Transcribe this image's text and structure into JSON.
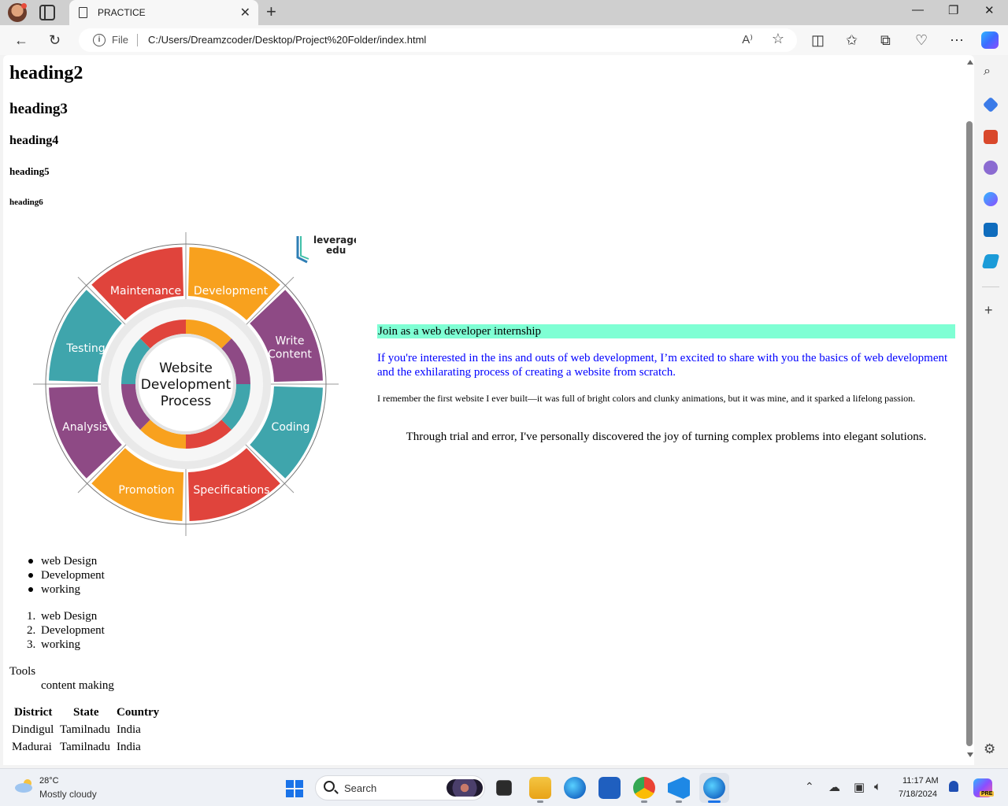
{
  "browser": {
    "tab_title": "PRACTICE",
    "file_label": "File",
    "url": "C:/Users/Dreamzcoder/Desktop/Project%20Folder/index.html"
  },
  "page": {
    "headings": {
      "h2": "heading2",
      "h3": "heading3",
      "h4": "heading4",
      "h5": "heading5",
      "h6": "heading6"
    },
    "diagram": {
      "brand_top": "leverage",
      "brand_bottom": "edu",
      "center_lines": [
        "Website",
        "Development",
        "Process"
      ],
      "segments": [
        "Development",
        "Write Content",
        "Coding",
        "Specifications",
        "Promotion",
        "Analysis",
        "Testing",
        "Maintenance"
      ]
    },
    "banner": "Join as a web developer internship",
    "intro": "If you're interested in the ins and outs of web development, I’m excited to share with you the basics of web development and the exhilarating process of creating a website from scratch.",
    "memory": "I remember the first website I ever built—it was full of bright colors and clunky animations, but it was mine, and it sparked a lifelong passion.",
    "trial": "Through trial and error, I've personally discovered the joy of turning complex problems into elegant solutions.",
    "unordered_list": [
      "web Design",
      "Development",
      "working"
    ],
    "ordered_list": [
      "web Design",
      "Development",
      "working"
    ],
    "description": {
      "term": "Tools",
      "detail": "content making"
    },
    "table": {
      "headers": [
        "District",
        "State",
        "Country"
      ],
      "rows": [
        [
          "Dindigul",
          "Tamilnadu",
          "India"
        ],
        [
          "Madurai",
          "Tamilnadu",
          "India"
        ]
      ]
    }
  },
  "taskbar": {
    "temperature": "28°C",
    "weather": "Mostly cloudy",
    "search_label": "Search",
    "time": "11:17 AM",
    "date": "7/18/2024",
    "pre_badge": "PRE"
  },
  "colors": {
    "banner_bg": "#7fffd4",
    "intro_text": "#0000ff",
    "seg_red": "#e0443c",
    "seg_orange": "#f8a11e",
    "seg_purple": "#8e4a85",
    "seg_teal": "#3fa5ac"
  }
}
